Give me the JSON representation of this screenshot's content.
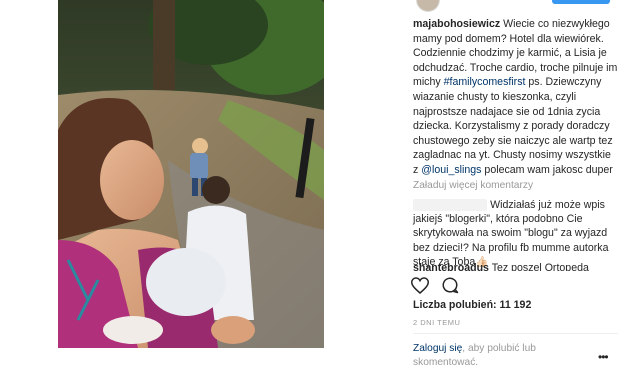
{
  "post": {
    "username": "majabohosiewicz",
    "caption_text": "Wiecie co niezwykłego mamy pod domem? Hotel dla wiewiórek. Codziennie chodzimy je karmić, a Lisia je odchudzać. Troche cardio, troche pilnuje im michy ",
    "caption_hashtag": "#familycomesfirst",
    "caption_text_2": " ps. Dziewczyny wiazanie chusty to kieszonka, czyli najprostsze nadajace sie od 1dnia zycia dziecka. Korzystalismy z porady doradczy chustowego zeby sie naiczyc ale wartp tez zagladnac na yt. Chusty nosimy wszystkie z ",
    "caption_mention": "@loui_slings",
    "caption_text_3": " polecam wam jakosc duper",
    "load_more": "Załaduj więcej komentarzy",
    "comments": [
      {
        "text": "Widziałaś już może wpis jakiejś \"blogerki\", która podobno Cie skrytykowała na swoim \"blogu\" za wyjazd bez dzieci!? Na profilu fb mumme autorka staje za Toba👍🏻"
      },
      {
        "username": "shantebroadus",
        "text": "Tez poszel Ortopeda"
      }
    ],
    "likes": "Liczba polubień: 11 192",
    "time": "2 DNI TEMU",
    "login_link": "Zaloguj się",
    "login_text": ", aby polubić lub skomentować.",
    "more_options": "•••"
  },
  "icons": [
    "heart-icon",
    "comment-icon",
    "more-options-icon"
  ]
}
